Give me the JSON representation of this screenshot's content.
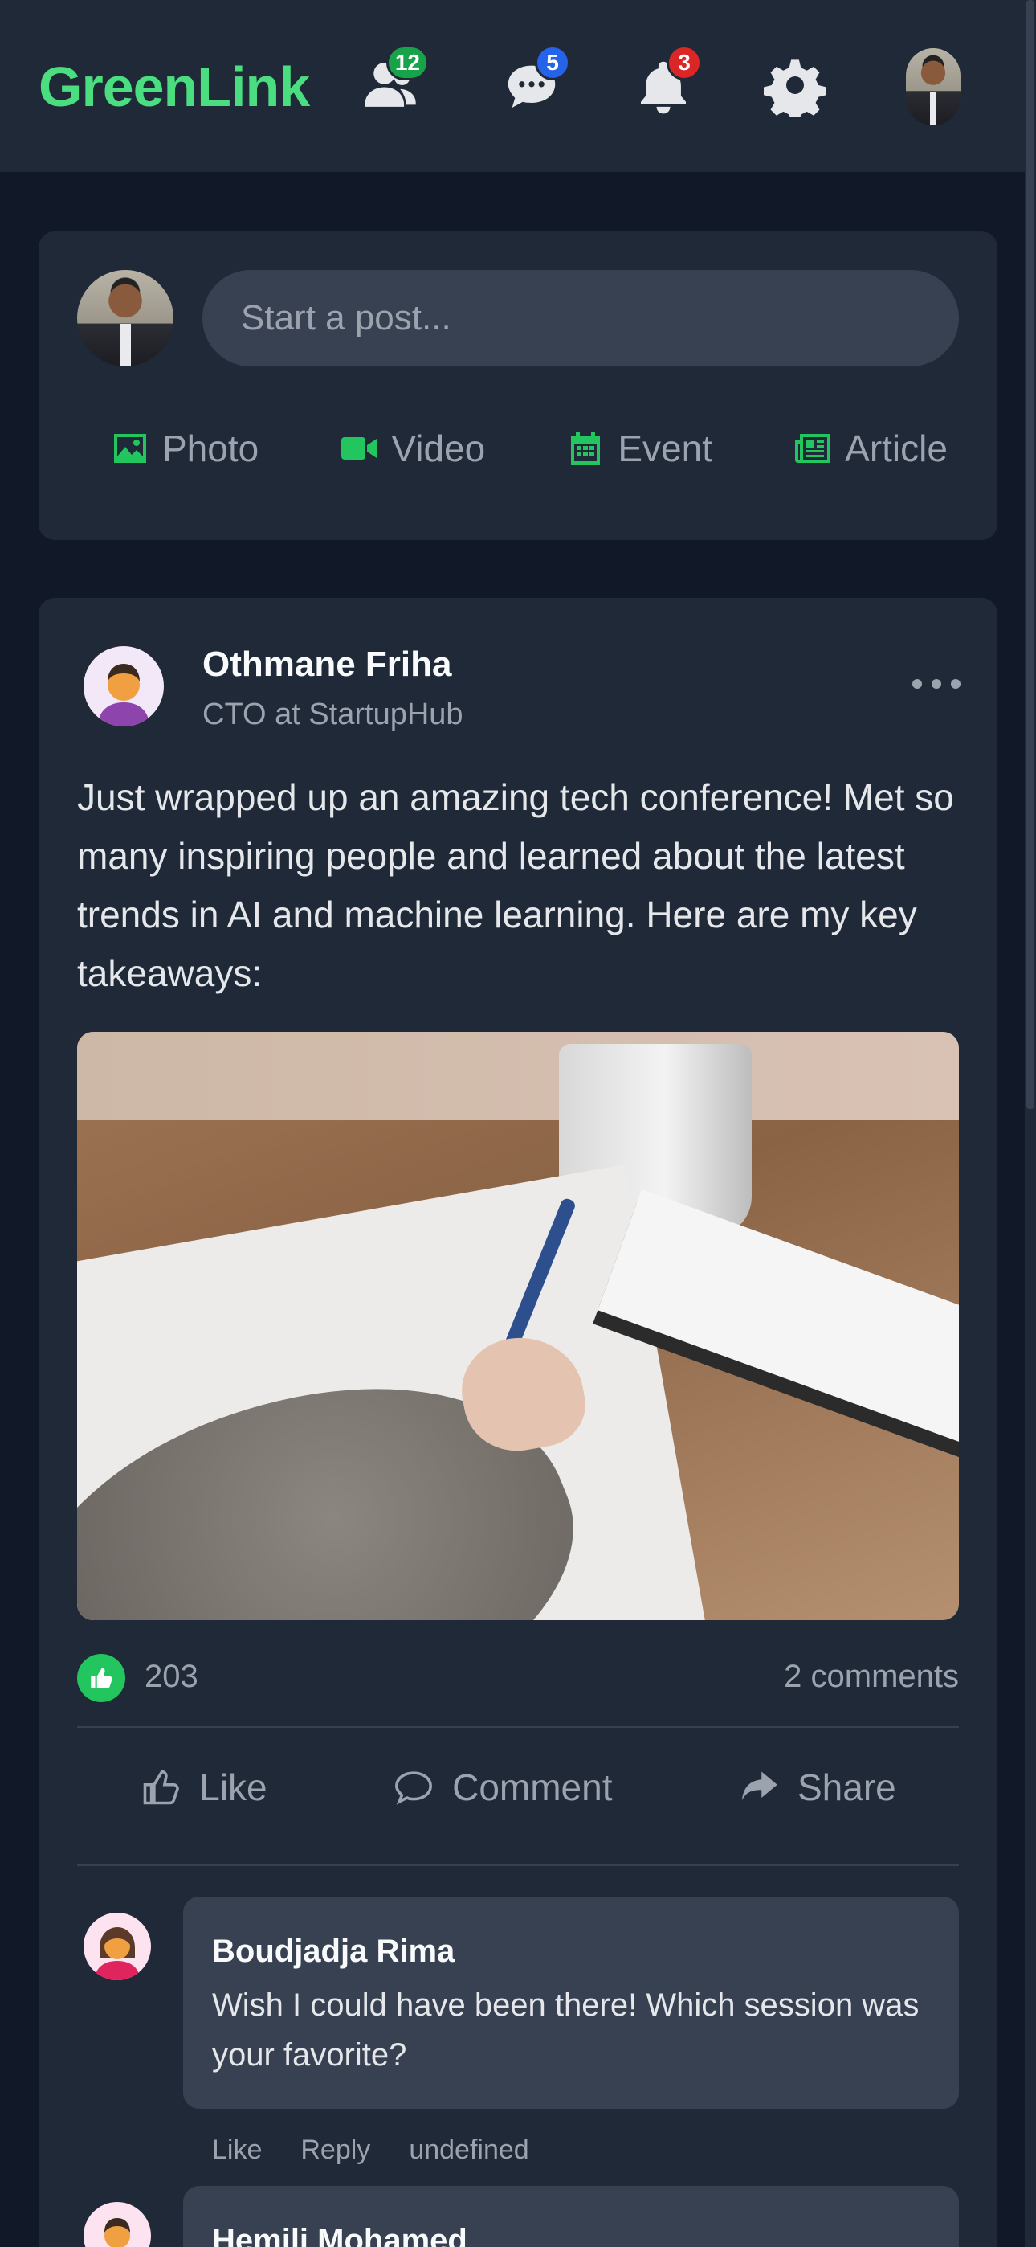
{
  "header": {
    "logo": "GreenLink",
    "badges": {
      "network": "12",
      "messages": "5",
      "notifications": "3"
    }
  },
  "composer": {
    "placeholder": "Start a post...",
    "actions": [
      {
        "label": "Photo",
        "icon": "image-icon"
      },
      {
        "label": "Video",
        "icon": "video-icon"
      },
      {
        "label": "Event",
        "icon": "calendar-icon"
      },
      {
        "label": "Article",
        "icon": "newspaper-icon"
      }
    ]
  },
  "post": {
    "author": "Othmane Friha",
    "role": "CTO at StartupHub",
    "body": "Just wrapped up an amazing tech conference! Met so many inspiring people and learned about the latest trends in AI and machine learning. Here are my key takeaways:",
    "likes": "203",
    "comments_count": "2 comments",
    "actions": {
      "like": "Like",
      "comment": "Comment",
      "share": "Share"
    }
  },
  "comments": [
    {
      "name": "Boudjadja Rima",
      "text": "Wish I could have been there! Which session was your favorite?",
      "meta": {
        "like": "Like",
        "reply": "Reply",
        "time": "undefined"
      }
    },
    {
      "name": "Hemili Mohamed"
    }
  ],
  "colors": {
    "accent": "#4ade80",
    "background": "#111827",
    "card": "#1f2937",
    "badge_green": "#16a34a",
    "badge_blue": "#2563eb",
    "badge_red": "#dc2626"
  }
}
